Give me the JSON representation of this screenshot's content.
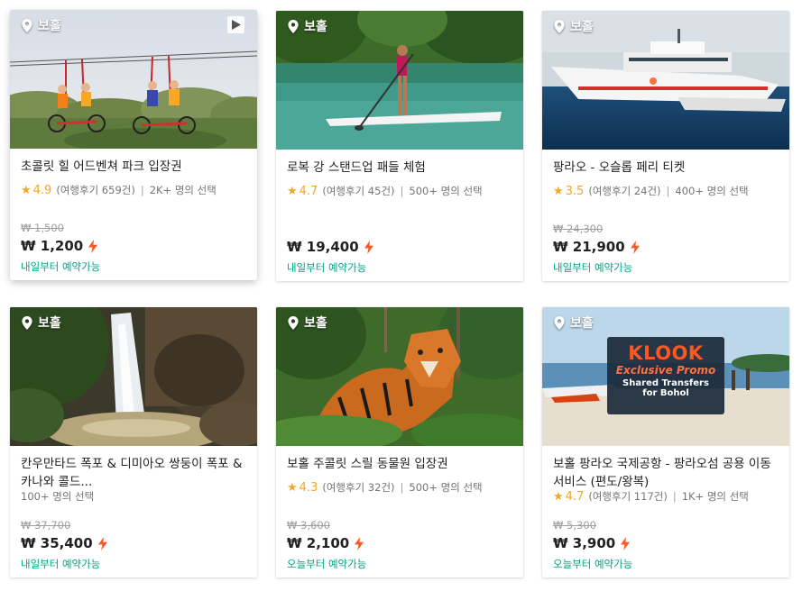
{
  "cards": [
    {
      "location": "보홀",
      "title": "초콜릿 힐 어드벤쳐 파크 입장권",
      "rating": "4.9",
      "reviews": "(여행후기 659건)",
      "booked": "2K+ 명의 선택",
      "old_price": "₩ 1,500",
      "price": "₩ 1,200",
      "availability": "내일부터 예약가능",
      "has_video": true,
      "image": "chocolate-hills-sky-bike"
    },
    {
      "location": "보홀",
      "title": "로복 강 스탠드업 패들 체험",
      "rating": "4.7",
      "reviews": "(여행후기 45건)",
      "booked": "500+ 명의 선택",
      "old_price": "",
      "price": "₩ 19,400",
      "availability": "내일부터 예약가능",
      "has_video": false,
      "image": "loboc-river-paddle"
    },
    {
      "location": "보홀",
      "title": "팡라오 - 오슬롭 페리 티켓",
      "rating": "3.5",
      "reviews": "(여행후기 24건)",
      "booked": "400+ 명의 선택",
      "old_price": "₩ 24,300",
      "price": "₩ 21,900",
      "availability": "내일부터 예약가능",
      "has_video": false,
      "image": "ferry-boat"
    },
    {
      "location": "보홀",
      "title": "칸우만타드 폭포 & 디미아오 쌍둥이 폭포 & 카나와 콜드...",
      "rating": "",
      "reviews": "",
      "booked": "100+ 명의 선택",
      "old_price": "₩ 37,700",
      "price": "₩ 35,400",
      "availability": "내일부터 예약가능",
      "has_video": false,
      "image": "waterfall"
    },
    {
      "location": "보홀",
      "title": "보홀 주콜릿 스릴 동물원 입장권",
      "rating": "4.3",
      "reviews": "(여행후기 32건)",
      "booked": "500+ 명의 선택",
      "old_price": "₩ 3,600",
      "price": "₩ 2,100",
      "availability": "오늘부터 예약가능",
      "has_video": false,
      "image": "tiger"
    },
    {
      "location": "보홀",
      "title": "보홀 팡라오 국제공항 - 팡라오섬 공용 이동 서비스 (편도/왕복)",
      "rating": "4.7",
      "reviews": "(여행후기 117건)",
      "booked": "1K+ 명의 선택",
      "old_price": "₩ 5,300",
      "price": "₩ 3,900",
      "availability": "오늘부터 예약가능",
      "has_video": false,
      "image": "klook-promo-beach",
      "promo": {
        "brand": "KLOOK",
        "tag": "Exclusive Promo",
        "line1": "Shared Transfers",
        "line2": "for Bohol"
      }
    }
  ],
  "colors": {
    "star": "#f5a623",
    "availability": "#00a383",
    "lightning": "#ff5722",
    "klook": "#ff5722"
  }
}
